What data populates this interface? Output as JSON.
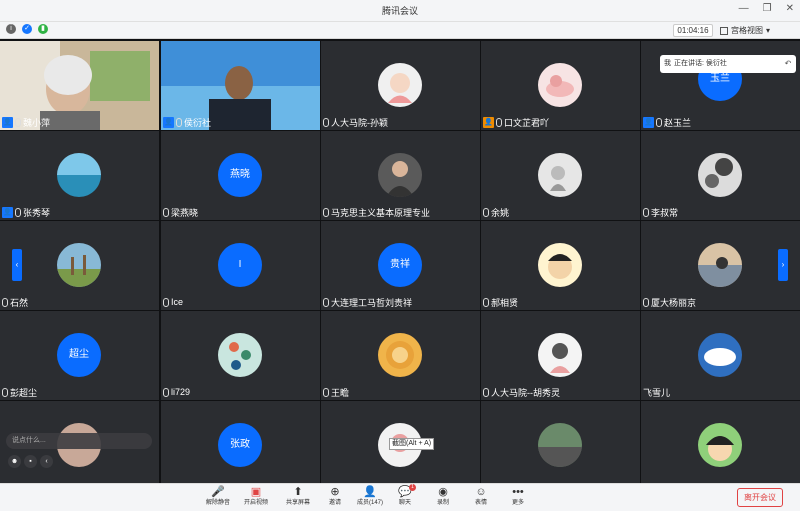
{
  "window": {
    "title": "腾讯会议",
    "timer": "01:04:16",
    "view_label": "宫格视图"
  },
  "speaking": {
    "prefix": "我",
    "label": "正在讲话: 侯衍社"
  },
  "chat": {
    "placeholder": "说点什么..."
  },
  "tooltip": "截图(Alt + A)",
  "participants": [
    "魏小萍",
    "侯衍社",
    "人大马院-孙颖",
    "口文芷君吖",
    "赵玉兰",
    "张秀琴",
    "梁燕晓",
    "马克思主义基本原理专业",
    "余姚",
    "李叔常",
    "石然",
    "Ice",
    "大连理工马哲刘贵祥",
    "郝相贤",
    "厦大杨丽京",
    "彭超尘",
    "li729",
    "王瞻",
    "人大马院--胡秀灵",
    "飞雪儿"
  ],
  "avatars_text": {
    "t4": "玉兰",
    "t6": "燕晓",
    "t11": "I",
    "t12": "贵祥",
    "t15": "超尘",
    "t21": "张政"
  },
  "bottom": {
    "mute": "解除静音",
    "video": "开启视频",
    "share": "共享屏幕",
    "invite": "邀请",
    "members": "成员(147)",
    "chat": "聊天",
    "chat_badge": "1",
    "record": "录制",
    "reaction": "表情",
    "more": "更多",
    "leave": "离开会议"
  }
}
